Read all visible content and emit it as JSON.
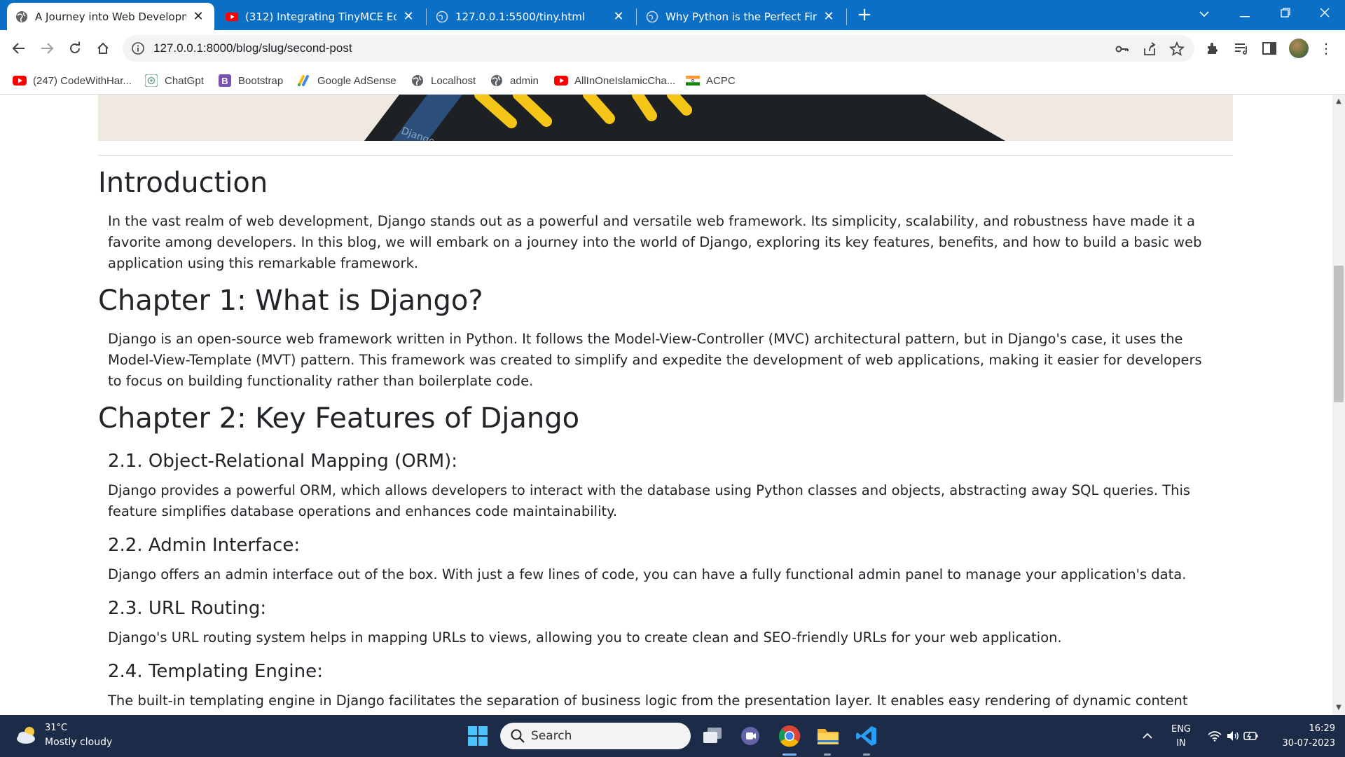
{
  "browser": {
    "tabs": [
      {
        "title": "A Journey into Web Developmen",
        "icon": "globe-icon",
        "active": true
      },
      {
        "title": "(312) Integrating TinyMCE Editor",
        "icon": "youtube-icon",
        "active": false
      },
      {
        "title": "127.0.0.1:5500/tiny.html",
        "icon": "globe-icon",
        "active": false
      },
      {
        "title": "Why Python is the Perfect First Pr",
        "icon": "globe-icon",
        "active": false
      }
    ],
    "new_tab_label": "+",
    "url": "127.0.0.1:8000/blog/slug/second-post"
  },
  "bookmarks": [
    {
      "label": "(247) CodeWithHar...",
      "icon": "youtube-icon"
    },
    {
      "label": "ChatGpt",
      "icon": "chatgpt-icon"
    },
    {
      "label": "Bootstrap",
      "icon": "bootstrap-icon"
    },
    {
      "label": "Google AdSense",
      "icon": "adsense-icon"
    },
    {
      "label": "Localhost",
      "icon": "globe-icon"
    },
    {
      "label": "admin",
      "icon": "globe-icon"
    },
    {
      "label": "AllInOneIslamicCha...",
      "icon": "youtube-icon"
    },
    {
      "label": "ACPC",
      "icon": "india-flag-icon"
    }
  ],
  "article": {
    "intro_heading": "Introduction",
    "intro_text": "In the vast realm of web development, Django stands out as a powerful and versatile web framework. Its simplicity, scalability, and robustness have made it a favorite among developers. In this blog, we will embark on a journey into the world of Django, exploring its key features, benefits, and how to build a basic web application using this remarkable framework.",
    "ch1_heading": "Chapter 1: What is Django?",
    "ch1_text": "Django is an open-source web framework written in Python. It follows the Model-View-Controller (MVC) architectural pattern, but in Django's case, it uses the Model-View-Template (MVT) pattern. This framework was created to simplify and expedite the development of web applications, making it easier for developers to focus on building functionality rather than boilerplate code.",
    "ch2_heading": "Chapter 2: Key Features of Django",
    "s21_heading": "2.1. Object-Relational Mapping (ORM):",
    "s21_text": "Django provides a powerful ORM, which allows developers to interact with the database using Python classes and objects, abstracting away SQL queries. This feature simplifies database operations and enhances code maintainability.",
    "s22_heading": "2.2. Admin Interface:",
    "s22_text": "Django offers an admin interface out of the box. With just a few lines of code, you can have a fully functional admin panel to manage your application's data.",
    "s23_heading": "2.3. URL Routing:",
    "s23_text": "Django's URL routing system helps in mapping URLs to views, allowing you to create clean and SEO-friendly URLs for your web application.",
    "s24_heading": "2.4. Templating Engine:",
    "s24_text": "The built-in templating engine in Django facilitates the separation of business logic from the presentation layer. It enables easy rendering of dynamic content"
  },
  "taskbar": {
    "weather_temp": "31°C",
    "weather_desc": "Mostly cloudy",
    "search_label": "Search",
    "language": "ENG",
    "region": "IN",
    "time": "16:29",
    "date": "30-07-2023"
  }
}
